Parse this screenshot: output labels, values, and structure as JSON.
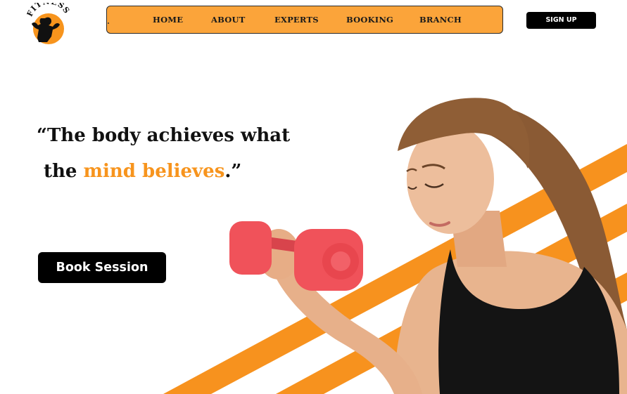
{
  "brand": {
    "logo_text": "FITNESS",
    "logo_icon": "athlete-silhouette-icon"
  },
  "nav": {
    "items": [
      {
        "label": "HOME"
      },
      {
        "label": "ABOUT"
      },
      {
        "label": "EXPERTS"
      },
      {
        "label": "BOOKING"
      },
      {
        "label": "BRANCH"
      }
    ]
  },
  "header": {
    "signup_label": "SIGN UP"
  },
  "hero": {
    "quote_line1": "“The body achieves what",
    "quote_line2_prefix": "the ",
    "quote_accent": "mind believes",
    "quote_suffix": ".”",
    "cta_label": "Book Session",
    "image": "woman-lifting-dumbbell"
  },
  "colors": {
    "accent": "#F7941D",
    "navbar_bg": "#FBA43A",
    "button_bg": "#000000",
    "button_text": "#FFFFFF",
    "stripes": "#F7921E",
    "dumbbell": "#F0525A"
  }
}
